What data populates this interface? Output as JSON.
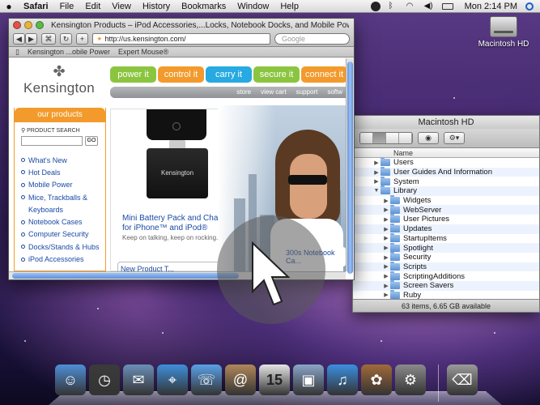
{
  "menubar": {
    "apple": "",
    "items": [
      "Safari",
      "File",
      "Edit",
      "View",
      "History",
      "Bookmarks",
      "Window",
      "Help"
    ],
    "clock": "Mon 2:14 PM"
  },
  "desktop": {
    "hd_label": "Macintosh HD"
  },
  "safari": {
    "title": "Kensington Products – iPod Accessories,...Locks, Notebook Docks, and Mobile Power",
    "url": "http://us.kensington.com/",
    "search_placeholder": "Google",
    "bookmarks": [
      "Kensington ...obile Power",
      "Expert Mouse®"
    ],
    "page": {
      "logo": "Kensington",
      "tabs": [
        {
          "label": "power it",
          "color": "#8bc53f"
        },
        {
          "label": "control it",
          "color": "#f39a2c"
        },
        {
          "label": "carry it",
          "color": "#27a9e1"
        },
        {
          "label": "secure it",
          "color": "#8bc53f"
        },
        {
          "label": "connect it",
          "color": "#f39a2c"
        }
      ],
      "subnav": [
        "store",
        "view cart",
        "support",
        "softw"
      ],
      "sidebar": {
        "header": "our products",
        "search_label": "PRODUCT SEARCH",
        "go": "GO",
        "items": [
          "What's New",
          "Hot Deals",
          "Mobile Power",
          "Mice, Trackballs &",
          "Keyboards",
          "Notebook Cases",
          "Computer Security",
          "Docks/Stands & Hubs",
          "iPod Accessories"
        ]
      },
      "promo": {
        "title": "Mini Battery Pack and Charger for iPhone™ and iPod®",
        "subtitle": "Keep on talking, keep on rocking.",
        "charger_label": "Kensington",
        "box": "New Product T..."
      },
      "hero_caption": "300s Notebook Ca..."
    }
  },
  "finder": {
    "title": "Macintosh HD",
    "col_name": "Name",
    "rows": [
      {
        "label": "Users",
        "level": 0,
        "open": false
      },
      {
        "label": "User Guides And Information",
        "level": 0,
        "open": false
      },
      {
        "label": "System",
        "level": 0,
        "open": false
      },
      {
        "label": "Library",
        "level": 0,
        "open": true
      },
      {
        "label": "Widgets",
        "level": 1,
        "open": false
      },
      {
        "label": "WebServer",
        "level": 1,
        "open": false
      },
      {
        "label": "User Pictures",
        "level": 1,
        "open": false
      },
      {
        "label": "Updates",
        "level": 1,
        "open": false
      },
      {
        "label": "StartupItems",
        "level": 1,
        "open": false
      },
      {
        "label": "Spotlight",
        "level": 1,
        "open": false
      },
      {
        "label": "Security",
        "level": 1,
        "open": false
      },
      {
        "label": "Scripts",
        "level": 1,
        "open": false
      },
      {
        "label": "ScriptingAdditions",
        "level": 1,
        "open": false
      },
      {
        "label": "Screen Savers",
        "level": 1,
        "open": false
      },
      {
        "label": "Ruby",
        "level": 1,
        "open": false
      }
    ],
    "status": "63 items, 6.65 GB available"
  },
  "dock": {
    "items": [
      {
        "name": "finder",
        "glyph": "☺",
        "color": "#4f8fd8"
      },
      {
        "name": "dashboard",
        "glyph": "◷",
        "color": "#3b3b3b"
      },
      {
        "name": "mail",
        "glyph": "✉",
        "color": "#6b8fb8"
      },
      {
        "name": "safari",
        "glyph": "⌖",
        "color": "#3e8fdc"
      },
      {
        "name": "ichat",
        "glyph": "☏",
        "color": "#5aa0e8"
      },
      {
        "name": "address-book",
        "glyph": "@",
        "color": "#b0875a"
      },
      {
        "name": "ical",
        "glyph": "15",
        "color": "#e5e5e5"
      },
      {
        "name": "preview",
        "glyph": "▣",
        "color": "#8aa6c8"
      },
      {
        "name": "itunes",
        "glyph": "♫",
        "color": "#3b8fe0"
      },
      {
        "name": "iphoto",
        "glyph": "✿",
        "color": "#a06a3a"
      },
      {
        "name": "system-preferences",
        "glyph": "⚙",
        "color": "#8a8a8a"
      },
      {
        "name": "trash",
        "glyph": "⌫",
        "color": "#9a9a9a"
      }
    ]
  }
}
